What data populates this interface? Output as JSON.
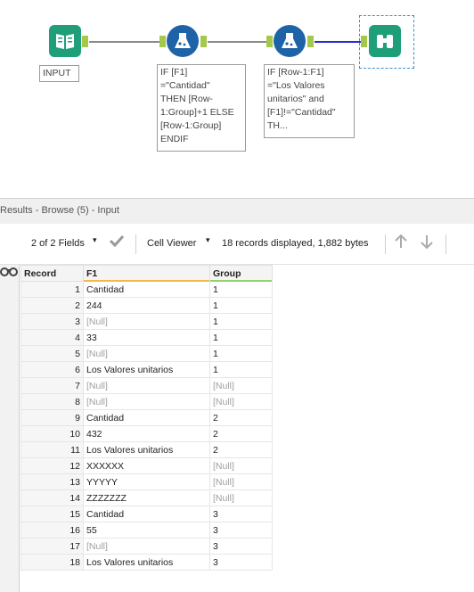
{
  "canvas": {
    "input_annotation": "INPUT",
    "formula1_annotation": "IF [F1]\n=\"Cantidad\"\nTHEN [Row-\n1:Group]+1 ELSE\n[Row-1:Group]\nENDIF",
    "formula2_annotation": "IF [Row-1:F1]\n=\"Los Valores\nunitarios\" and\n[F1]!=\"Cantidad\"\nTH..."
  },
  "results": {
    "title": "Results - Browse (5) - Input",
    "fields_label": "2 of 2 Fields",
    "viewer_label": "Cell Viewer",
    "status": "18 records displayed, 1,882 bytes"
  },
  "grid": {
    "headers": [
      "Record",
      "F1",
      "Group"
    ],
    "rows": [
      {
        "record": "1",
        "f1": "Cantidad",
        "group": "1"
      },
      {
        "record": "2",
        "f1": "244",
        "group": "1"
      },
      {
        "record": "3",
        "f1": "[Null]",
        "group": "1"
      },
      {
        "record": "4",
        "f1": "33",
        "group": "1"
      },
      {
        "record": "5",
        "f1": "[Null]",
        "group": "1"
      },
      {
        "record": "6",
        "f1": "Los Valores unitarios",
        "group": "1"
      },
      {
        "record": "7",
        "f1": "[Null]",
        "group": "[Null]"
      },
      {
        "record": "8",
        "f1": "[Null]",
        "group": "[Null]"
      },
      {
        "record": "9",
        "f1": "Cantidad",
        "group": "2"
      },
      {
        "record": "10",
        "f1": "432",
        "group": "2"
      },
      {
        "record": "11",
        "f1": "Los Valores unitarios",
        "group": "2"
      },
      {
        "record": "12",
        "f1": "XXXXXX",
        "group": "[Null]"
      },
      {
        "record": "13",
        "f1": "YYYYY",
        "group": "[Null]"
      },
      {
        "record": "14",
        "f1": "ZZZZZZZ",
        "group": "[Null]"
      },
      {
        "record": "15",
        "f1": "Cantidad",
        "group": "3"
      },
      {
        "record": "16",
        "f1": "55",
        "group": "3"
      },
      {
        "record": "17",
        "f1": "[Null]",
        "group": "3"
      },
      {
        "record": "18",
        "f1": "Los Valores unitarios",
        "group": "3"
      }
    ]
  },
  "colors": {
    "input_tool": "#1f9e7a",
    "formula_tool": "#1e63a8",
    "browse_tool": "#1f9e7a",
    "anchor": "#a6c84a",
    "active_connection": "#2b2bd6",
    "f1_underline": "#f2b84b",
    "group_underline": "#8fd36a",
    "null_text": "#a0a0a0"
  }
}
